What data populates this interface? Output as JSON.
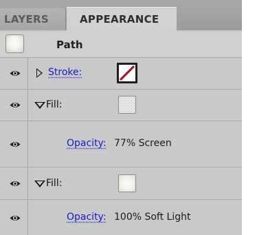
{
  "tabs": [
    {
      "label": "LAYERS",
      "active": false
    },
    {
      "label": "APPEARANCE",
      "active": true
    }
  ],
  "object": {
    "label": "Path",
    "thumbnail": "radial-white-swatch"
  },
  "rows": [
    {
      "type": "stroke",
      "label": "Stroke:",
      "expanded": false,
      "visible": true,
      "swatch": "none-swatch-red-slash"
    },
    {
      "type": "fill",
      "label": "Fill:",
      "expanded": true,
      "visible": true,
      "swatch": "textured-white-swatch"
    },
    {
      "type": "opacity",
      "label": "Opacity:",
      "value": "77% Screen",
      "visible": true
    },
    {
      "type": "fill",
      "label": "Fill:",
      "expanded": true,
      "visible": true,
      "swatch": "radial-white-swatch"
    },
    {
      "type": "opacity",
      "label": "Opacity:",
      "value": "100% Soft Light",
      "visible": true
    }
  ],
  "colors": {
    "link": "#1a1ac8",
    "none_slash": "#9e1a2a",
    "panel_bg": "#c9c9c9"
  }
}
